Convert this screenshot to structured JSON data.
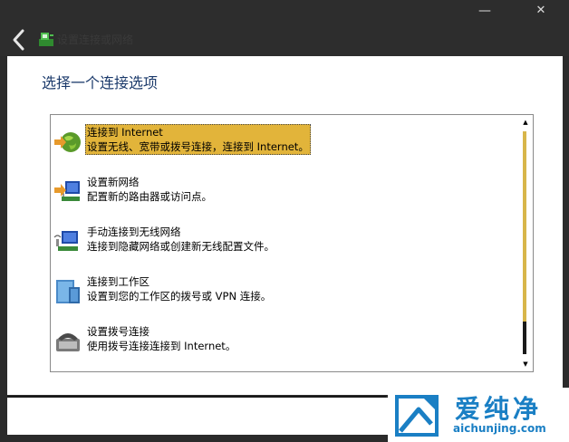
{
  "window": {
    "minimize_glyph": "—",
    "close_glyph": "✕",
    "back_icon": "back-arrow-icon",
    "wizard_icon": "network-wizard-icon",
    "title": "设置连接或网络"
  },
  "main": {
    "heading": "选择一个连接选项",
    "options": [
      {
        "icon": "globe-connect-icon",
        "title": "连接到 Internet",
        "description": "设置无线、宽带或拨号连接，连接到 Internet。",
        "selected": true
      },
      {
        "icon": "new-network-icon",
        "title": "设置新网络",
        "description": "配置新的路由器或访问点。",
        "selected": false
      },
      {
        "icon": "wireless-network-icon",
        "title": "手动连接到无线网络",
        "description": "连接到隐藏网络或创建新无线配置文件。",
        "selected": false
      },
      {
        "icon": "workplace-icon",
        "title": "连接到工作区",
        "description": "设置到您的工作区的拨号或 VPN 连接。",
        "selected": false
      },
      {
        "icon": "dialup-phone-icon",
        "title": "设置拨号连接",
        "description": "使用拨号连接连接到 Internet。",
        "selected": false
      }
    ],
    "scroll_up_glyph": "▲",
    "scroll_down_glyph": "▼"
  },
  "watermark": {
    "brand": "爱纯净",
    "url": "aichunjing.com"
  },
  "colors": {
    "selection": "#e2b43a",
    "heading": "#1b3a6b",
    "title_bar": "#2d2d2d",
    "watermark": "#1a7fc4"
  }
}
